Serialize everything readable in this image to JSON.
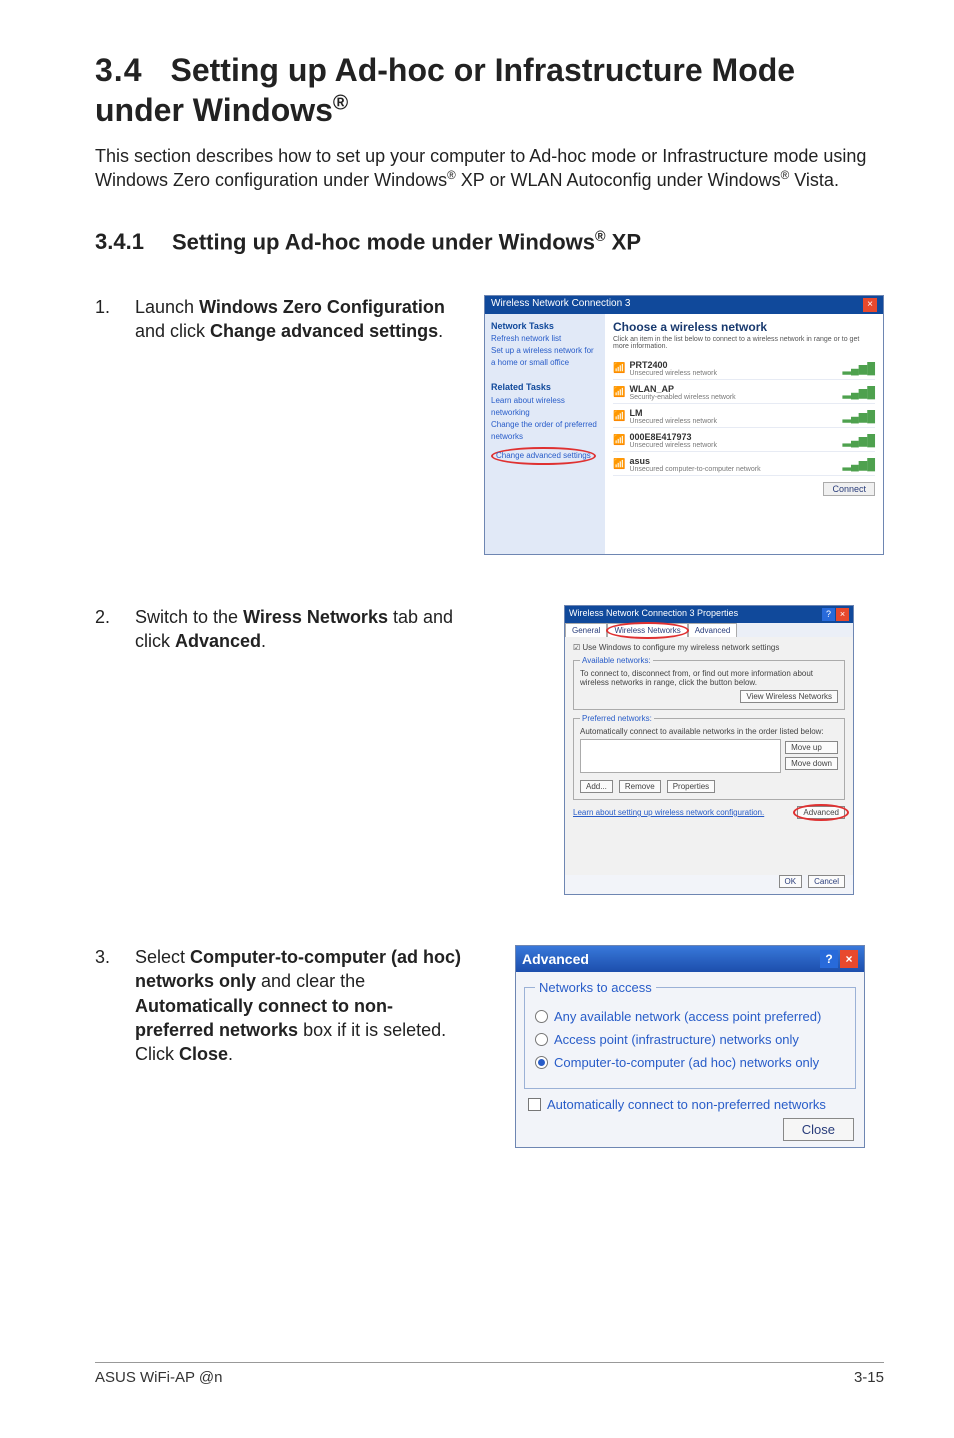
{
  "heading": {
    "num": "3.4",
    "text_a": "Setting up Ad-hoc or Infrastructure Mode under Windows",
    "reg": "®"
  },
  "intro_a": "This section describes how to set up your computer to Ad-hoc mode or Infrastructure mode using Windows Zero configuration under Windows",
  "intro_b": " XP or WLAN Autoconfig under Windows",
  "intro_c": " Vista.",
  "sub": {
    "num": "3.4.1",
    "text": "Setting up Ad-hoc mode under Windows",
    "reg": "®",
    "tail": " XP"
  },
  "step1": {
    "n": "1.",
    "a": "Launch ",
    "b": "Windows Zero Configuration",
    "c": " and click ",
    "d": "Change advanced settings",
    "e": "."
  },
  "step2": {
    "n": "2.",
    "a": "Switch to the ",
    "b": "Wiress Networks",
    "c": " tab and click ",
    "d": "Advanced",
    "e": "."
  },
  "step3": {
    "n": "3.",
    "a": "Select ",
    "b": "Computer-to-computer (ad hoc) networks only",
    "c": " and clear the ",
    "d": "Automatically connect to non-preferred networks",
    "e": " box if it is seleted. Click ",
    "f": "Close",
    "g": "."
  },
  "s1": {
    "title": "Wireless Network Connection 3",
    "choose": "Choose a wireless network",
    "sub": "Click an item in the list below to connect to a wireless network in range or to get more information.",
    "side_h1": "Network Tasks",
    "side_i1": "Refresh network list",
    "side_i2": "Set up a wireless network for a home or small office",
    "side_h2": "Related Tasks",
    "side_i3": "Learn about wireless networking",
    "side_i4": "Change the order of preferred networks",
    "side_i5": "Change advanced settings",
    "nets": [
      {
        "n": "PRT2400",
        "d": "Unsecured wireless network"
      },
      {
        "n": "WLAN_AP",
        "d": "Security-enabled wireless network"
      },
      {
        "n": "LM",
        "d": "Unsecured wireless network"
      },
      {
        "n": "000E8E417973",
        "d": "Unsecured wireless network"
      },
      {
        "n": "asus",
        "d": "Unsecured computer-to-computer network"
      }
    ],
    "connect": "Connect"
  },
  "s2": {
    "title": "Wireless Network Connection 3 Properties",
    "tabs": {
      "a": "General",
      "b": "Wireless Networks",
      "c": "Advanced"
    },
    "use": "Use Windows to configure my wireless network settings",
    "leg1": "Available networks:",
    "t1": "To connect to, disconnect from, or find out more information about wireless networks in range, click the button below.",
    "view": "View Wireless Networks",
    "leg2": "Preferred networks:",
    "t2": "Automatically connect to available networks in the order listed below:",
    "mu": "Move up",
    "md": "Move down",
    "add": "Add...",
    "rem": "Remove",
    "prop": "Properties",
    "learn": "Learn about setting up wireless network configuration.",
    "adv": "Advanced",
    "ok": "OK",
    "cancel": "Cancel"
  },
  "s3": {
    "title": "Advanced",
    "leg": "Networks to access",
    "o1": "Any available network (access point preferred)",
    "o2": "Access point (infrastructure) networks only",
    "o3": "Computer-to-computer (ad hoc) networks only",
    "auto": "Automatically connect to non-preferred networks",
    "close": "Close"
  },
  "footer": {
    "left": "ASUS WiFi-AP @n",
    "right": "3-15"
  }
}
